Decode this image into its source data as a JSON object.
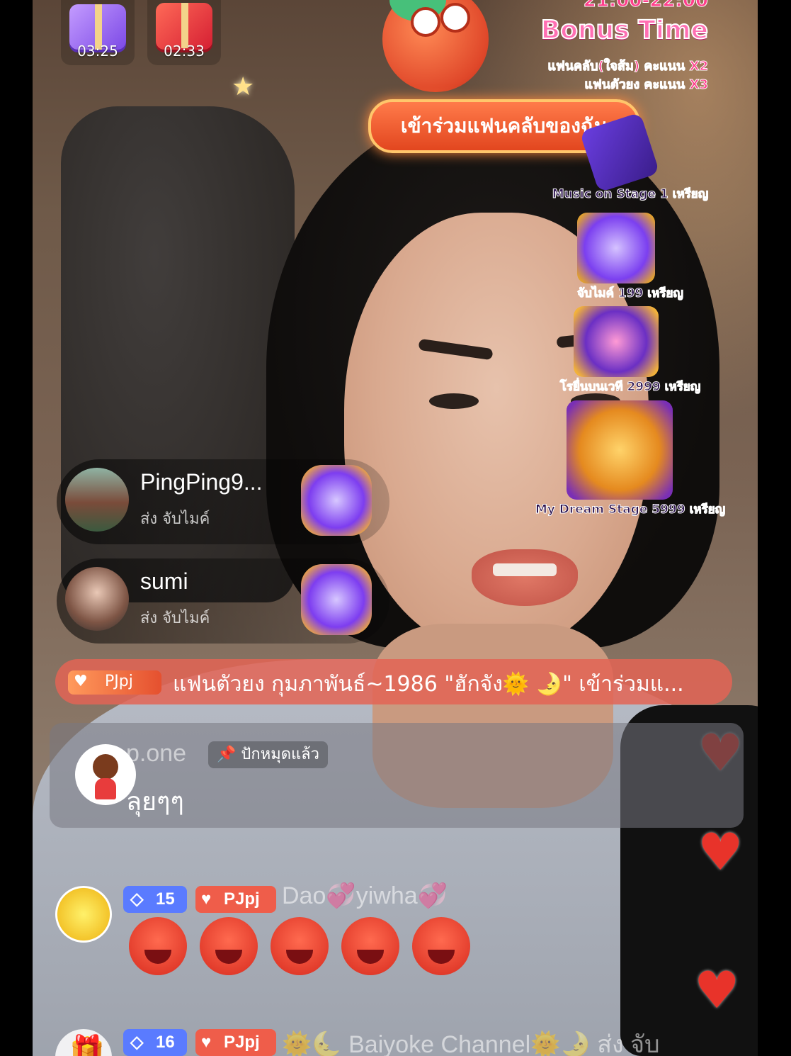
{
  "timers": [
    {
      "label": "03:25",
      "color": "#8b5cf6"
    },
    {
      "label": "02:33",
      "color": "#e11d48"
    }
  ],
  "bonus": {
    "time_range": "21:00-22:00",
    "title": "Bonus Time",
    "line1": "แฟนคลับ(ใจส้ม) คะแนน X2",
    "line2": "แฟนตัวยง คะแนน X3",
    "join_button": "เข้าร่วมแฟนคลับของฉัน"
  },
  "gifts_panel": [
    {
      "label": "Music on Stage 1 เหรียญ",
      "icon": "ticket-icon"
    },
    {
      "label": "จับไมค์ 199 เหรียญ",
      "icon": "microphone-gift-icon"
    },
    {
      "label": "โรยื่นบนเวที 2999 เหรียญ",
      "icon": "piano-gift-icon"
    },
    {
      "label": "My Dream Stage 5999 เหรียญ",
      "icon": "stage-gift-icon"
    }
  ],
  "gift_notifications": [
    {
      "user": "PingPing9...",
      "action": "ส่ง จับไมค์"
    },
    {
      "user": "sumi",
      "action": "ส่ง จับไมค์"
    }
  ],
  "fan_banner": {
    "badge": "PJpj",
    "text": "แฟนตัวยง กุมภาพันธ์~1986 \"ฮักจัง🌞 🌛\" เข้าร่วมแ..."
  },
  "pinned": {
    "user": "p.one",
    "tag": "ปักหมุดแล้ว",
    "message": "ลุยๆๆ"
  },
  "comments": [
    {
      "level": "15",
      "badge": "PJpj",
      "name": "Dao💞yiwha💞",
      "emoji_count": 5
    },
    {
      "level": "16",
      "badge": "PJpj",
      "name": "🌞🌜 Baiyoke Channel🌞🌛 ส่ง จับ"
    }
  ],
  "colors": {
    "heart": "#e8332a",
    "level_badge": "#5a7bff",
    "fan_badge": "#ef5d4a",
    "fan_banner_bg": "#e36455"
  }
}
